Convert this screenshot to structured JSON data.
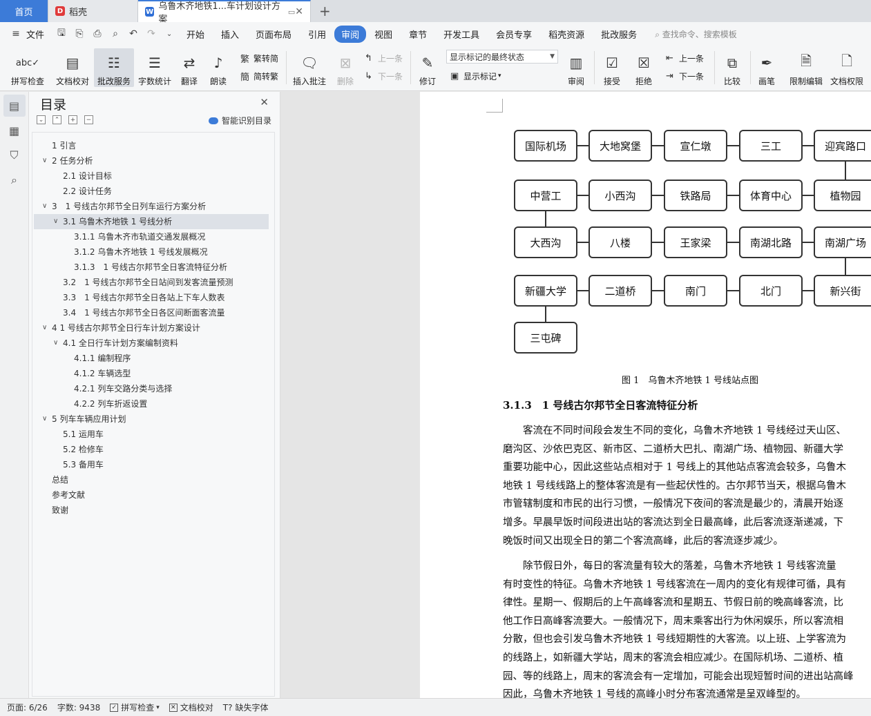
{
  "tabs": {
    "home": "首页",
    "doc1": "稻壳",
    "doc2": "乌鲁木齐地铁1...车计划设计方案"
  },
  "menu": {
    "file": "文件",
    "items": [
      "开始",
      "插入",
      "页面布局",
      "引用",
      "审阅",
      "视图",
      "章节",
      "开发工具",
      "会员专享",
      "稻壳资源",
      "批改服务"
    ],
    "search": "查找命令、搜索模板"
  },
  "ribbon": {
    "spell": "拼写检查",
    "proof": "文档校对",
    "grade": "批改服务",
    "count": "字数统计",
    "translate": "翻译",
    "read": "朗读",
    "t2s": "繁转简",
    "s2t": "简转繁",
    "add_comment": "插入批注",
    "delete": "删除",
    "prev": "上一条",
    "next": "下一条",
    "track": "修订",
    "combo_value": "显示标记的最终状态",
    "show_marks": "显示标记",
    "review": "审阅",
    "accept": "接受",
    "reject": "拒绝",
    "prev2": "上一条",
    "next2": "下一条",
    "compare": "比较",
    "pen": "画笔",
    "restrict": "限制编辑",
    "perm": "文档权限"
  },
  "toc": {
    "title": "目录",
    "smart": "智能识别目录",
    "items": [
      {
        "text": "1 引言",
        "level": 1,
        "tw": ""
      },
      {
        "text": "2 任务分析",
        "level": 1,
        "tw": "v"
      },
      {
        "text": "2.1 设计目标",
        "level": 2,
        "tw": ""
      },
      {
        "text": "2.2 设计任务",
        "level": 2,
        "tw": ""
      },
      {
        "text": "3　1 号线古尔邦节全日列车运行方案分析",
        "level": 1,
        "tw": "v"
      },
      {
        "text": "3.1 乌鲁木齐地铁 1 号线分析",
        "level": 2,
        "tw": "v",
        "sel": true
      },
      {
        "text": "3.1.1 乌鲁木齐市轨道交通发展概况",
        "level": 3,
        "tw": ""
      },
      {
        "text": "3.1.2 乌鲁木齐地铁 1 号线发展概况",
        "level": 3,
        "tw": ""
      },
      {
        "text": "3.1.3　1 号线古尔邦节全日客流特征分析",
        "level": 3,
        "tw": ""
      },
      {
        "text": "3.2　1 号线古尔邦节全日站间到发客流量预测",
        "level": 2,
        "tw": ""
      },
      {
        "text": "3.3　1 号线古尔邦节全日各站上下车人数表",
        "level": 2,
        "tw": ""
      },
      {
        "text": "3.4　1 号线古尔邦节全日各区间断面客流量",
        "level": 2,
        "tw": ""
      },
      {
        "text": "4 1 号线古尔邦节全日行车计划方案设计",
        "level": 1,
        "tw": "v"
      },
      {
        "text": "4.1 全日行车计划方案编制资料",
        "level": 2,
        "tw": "v"
      },
      {
        "text": "4.1.1 编制程序",
        "level": 3,
        "tw": ""
      },
      {
        "text": "4.1.2 车辆选型",
        "level": 3,
        "tw": ""
      },
      {
        "text": "4.2.1 列车交路分类与选择",
        "level": 3,
        "tw": ""
      },
      {
        "text": "4.2.2 列车折返设置",
        "level": 3,
        "tw": ""
      },
      {
        "text": "5 列车车辆应用计划",
        "level": 1,
        "tw": "v"
      },
      {
        "text": "5.1 运用车",
        "level": 2,
        "tw": ""
      },
      {
        "text": "5.2 检修车",
        "level": 2,
        "tw": ""
      },
      {
        "text": "5.3 备用车",
        "level": 2,
        "tw": ""
      },
      {
        "text": "总结",
        "level": 1,
        "tw": ""
      },
      {
        "text": "参考文献",
        "level": 1,
        "tw": ""
      },
      {
        "text": "致谢",
        "level": 1,
        "tw": ""
      }
    ]
  },
  "diagram": {
    "stations": [
      [
        "国际机场",
        "大地窝堡",
        "宣仁墩",
        "三工",
        "迎宾路口"
      ],
      [
        "中营工",
        "小西沟",
        "铁路局",
        "体育中心",
        "植物园"
      ],
      [
        "大西沟",
        "八楼",
        "王家梁",
        "南湖北路",
        "南湖广场"
      ],
      [
        "新疆大学",
        "二道桥",
        "南门",
        "北门",
        "新兴街"
      ],
      [
        "三屯碑"
      ]
    ],
    "caption": "图 1　乌鲁木齐地铁 1 号线站点图"
  },
  "document": {
    "heading": "3.1.3　1 号线古尔邦节全日客流特征分析",
    "para1": [
      "　　客流在不同时间段会发生不同的变化，乌鲁木齐地铁 1 号线经过天山区、",
      "磨沟区、沙依巴克区、新市区、二道桥大巴扎、南湖广场、植物园、新疆大学",
      "重要功能中心，因此这些站点相对于 1 号线上的其他站点客流会较多，乌鲁木",
      "地铁 1 号线线路上的整体客流是有一些起伏性的。古尔邦节当天，根据乌鲁木",
      "市管辖制度和市民的出行习惯，一般情况下夜间的客流是最少的，清晨开始逐",
      "增多。早晨早饭时间段进出站的客流达到全日最高峰，此后客流逐渐递减，下",
      "晚饭时间又出现全日的第二个客流高峰，此后的客流逐步减少。"
    ],
    "para2": [
      "　　除节假日外，每日的客流量有较大的落差，乌鲁木齐地铁 1 号线客流量",
      "有时变性的特征。乌鲁木齐地铁 1 号线客流在一周内的变化有规律可循，具有",
      "律性。星期一、假期后的上午高峰客流和星期五、节假日前的晚高峰客流，比",
      "他工作日高峰客流要大。一般情况下，周末乘客出行为休闲娱乐，所以客流相",
      "分散，但也会引发乌鲁木齐地铁 1 号线短期性的大客流。以上班、上学客流为",
      "的线路上，如新疆大学站，周末的客流会相应减少。在国际机场、二道桥、植",
      "园、等的线路上，周末的客流会有一定增加，可能会出现短暂时间的进出站高峰",
      "因此，乌鲁木齐地铁 1 号线的高峰小时分布客流通常是呈双峰型的。"
    ]
  },
  "status": {
    "page": "页面: 6/26",
    "words": "字数: 9438",
    "spell": "拼写检查",
    "proof": "文档校对",
    "font": "缺失字体"
  }
}
